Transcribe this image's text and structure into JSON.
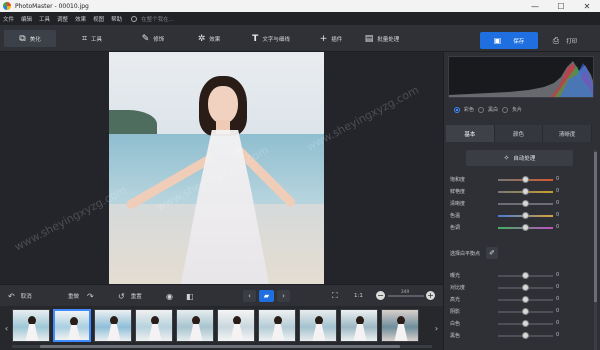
{
  "window": {
    "title": "PhotoMaster - 00010.jpg",
    "controls": [
      "—",
      "☐",
      "✕"
    ]
  },
  "menu": {
    "items": [
      "文件",
      "编辑",
      "工具",
      "调整",
      "效果",
      "视图",
      "帮助"
    ],
    "search_placeholder": "在整个我在..."
  },
  "toolbar": {
    "tools": [
      "美化",
      "工具",
      "修饰",
      "效果",
      "文字与细线",
      "插件",
      "批量处理"
    ],
    "icons": [
      "layers-icon",
      "crop-icon",
      "brush-icon",
      "fx-icon",
      "text-icon",
      "plus-icon",
      "batch-icon"
    ],
    "save_label": "保存",
    "print_label": "打印"
  },
  "watermark": "www.sheyingxyzg.com",
  "controls": {
    "undo_label": "取消",
    "redo_label": "重做",
    "reset_label": "重置",
    "ratio_label": "1:1",
    "zoom_value": "349"
  },
  "filmstrip": {
    "count": 10,
    "selected_index": 1
  },
  "histogram": {
    "modes": [
      "彩色",
      "黑白",
      "负片"
    ],
    "selected_mode": "彩色"
  },
  "panel": {
    "tabs": [
      "基本",
      "颜色",
      "清晰度"
    ],
    "active_tab": "基本",
    "auto_label": "自动处理",
    "sliders_top": [
      {
        "label": "饱和度",
        "value": "0",
        "pos": 0.5
      },
      {
        "label": "鲜艳度",
        "value": "0",
        "pos": 0.5
      },
      {
        "label": "清晰度",
        "value": "0",
        "pos": 0.5
      },
      {
        "label": "色温",
        "value": "0",
        "pos": 0.5
      },
      {
        "label": "色调",
        "value": "0",
        "pos": 0.5
      }
    ],
    "wb_label": "选择白平衡点",
    "sliders_bottom": [
      {
        "label": "曝光",
        "value": "0",
        "pos": 0.5
      },
      {
        "label": "对比度",
        "value": "0",
        "pos": 0.5
      },
      {
        "label": "高光",
        "value": "0",
        "pos": 0.5
      },
      {
        "label": "阴影",
        "value": "0",
        "pos": 0.5
      },
      {
        "label": "白色",
        "value": "0",
        "pos": 0.5
      },
      {
        "label": "黑色",
        "value": "0",
        "pos": 0.5
      }
    ]
  },
  "colors": {
    "accent": "#1f6fe0",
    "selection": "#3f8bff"
  }
}
